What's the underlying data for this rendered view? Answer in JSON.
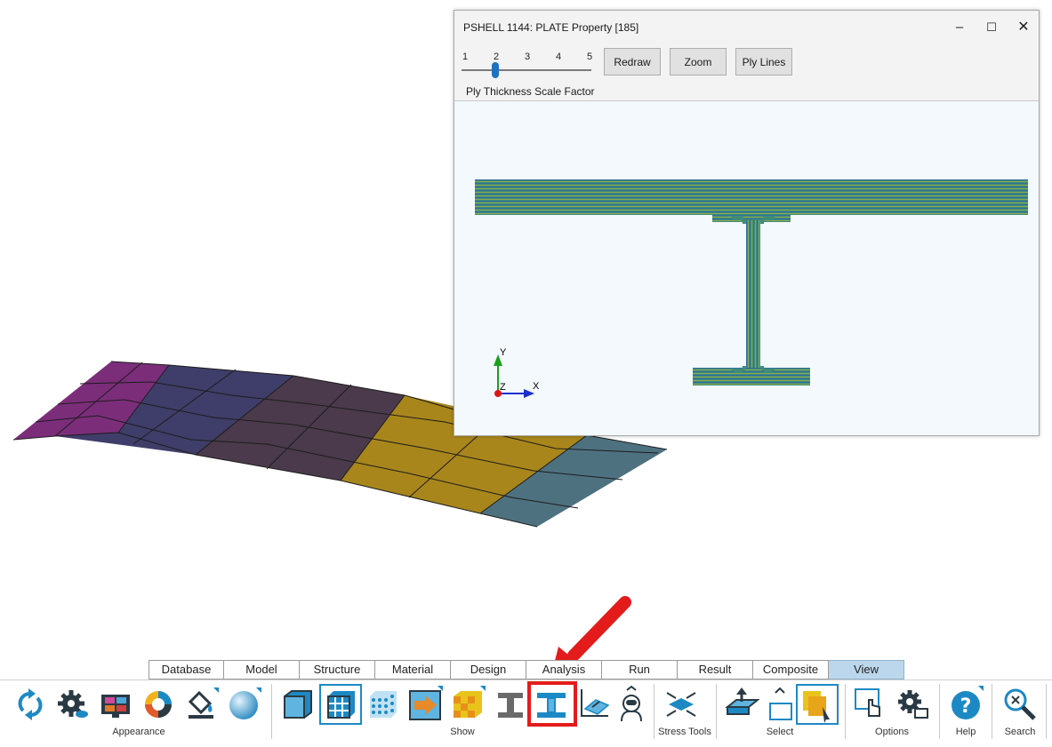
{
  "window": {
    "title": "PSHELL 1144: PLATE Property [185]",
    "controls": {
      "minimize": "–",
      "maximize": "☐",
      "close": "✕"
    },
    "scale": {
      "ticks": [
        "1",
        "2",
        "3",
        "4",
        "5"
      ],
      "value": 2,
      "min": 1,
      "max": 5,
      "label": "Ply Thickness Scale Factor"
    },
    "buttons": {
      "redraw": "Redraw",
      "zoom": "Zoom",
      "ply_lines": "Ply Lines"
    },
    "axes": {
      "y": "Y",
      "z": "Z",
      "x": "X"
    }
  },
  "ribbon": {
    "tabs": [
      "Database",
      "Model",
      "Structure",
      "Material",
      "Design",
      "Analysis",
      "Run",
      "Result",
      "Composite",
      "View"
    ],
    "active_tab": "View"
  },
  "toolbar": {
    "groups": {
      "appearance": "Appearance",
      "show": "Show",
      "stress_tools": "Stress Tools",
      "select": "Select",
      "options": "Options",
      "help": "Help",
      "search": "Search"
    },
    "icons": [
      "refresh-icon",
      "view-settings-gear-icon",
      "display-icon",
      "color-wheel-icon",
      "fill-bucket-icon",
      "sphere-icon",
      "solid-box-icon",
      "plate-grid-icon",
      "dotted-mesh-icon",
      "arrow-show-icon",
      "checker-pattern-icon",
      "ibeam-gray-icon",
      "ibeam-section-icon",
      "plane-chart-icon",
      "astronaut-icon",
      "stress-tools-icon",
      "select-plane-icon",
      "select-box-icon",
      "select-layers-icon",
      "touch-pointer-icon",
      "options-gear-icon",
      "help-icon",
      "search-icon"
    ],
    "colors": {
      "accent": "#1d89c4",
      "highlight": "#e41b1b"
    }
  },
  "model_colors": {
    "magenta": "#7b2d7a",
    "indigo": "#3f3d69",
    "plum": "#4a3a4b",
    "gold": "#a8861b",
    "teal": "#4e7180"
  }
}
